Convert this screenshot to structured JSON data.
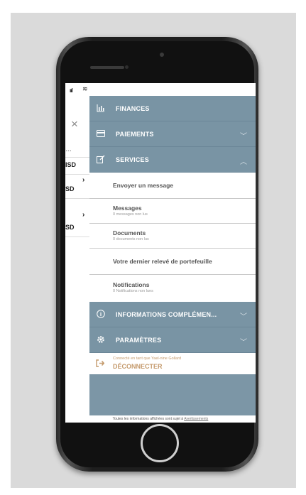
{
  "status": {
    "signal": "ııl",
    "wifi": "≋"
  },
  "background": {
    "close_icon": "×",
    "text_1": "…",
    "text_2": "ISD",
    "text_3": "SD",
    "text_4": "SD",
    "chevron": "›"
  },
  "menu": {
    "finances": "FINANCES",
    "paiements": "PAIEMENTS",
    "services": "SERVICES",
    "services_items": [
      {
        "title": "Envoyer un message",
        "subtitle": ""
      },
      {
        "title": "Messages",
        "subtitle": "0 messages non lus"
      },
      {
        "title": "Documents",
        "subtitle": "0 documents non lus"
      },
      {
        "title": "Votre dernier relevé de portefeuille",
        "subtitle": ""
      },
      {
        "title": "Notifications",
        "subtitle": "0 Notifications non lues"
      }
    ],
    "informations": "INFORMATIONS COMPLÉMEN...",
    "parametres": "PARAMÈTRES",
    "logout": {
      "connected_as": "Connecté en tant que Yael-nine Gollard",
      "label": "DÉCONNECTER"
    }
  },
  "footer": {
    "text": "Toutes les informations affichées sont sujet à",
    "link": "Avertissements"
  },
  "colors": {
    "menu_bg": "#7994a4",
    "accent": "#c49a6c"
  }
}
